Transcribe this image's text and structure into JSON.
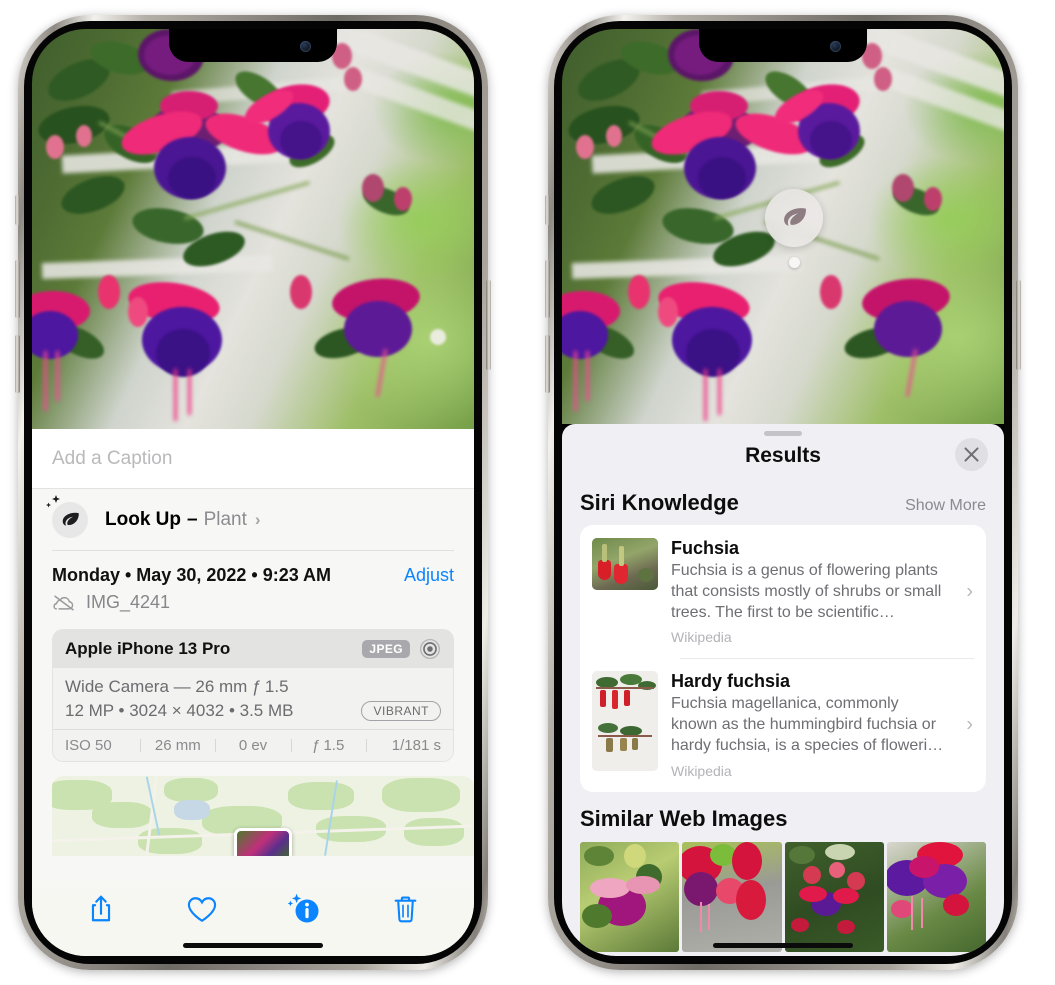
{
  "left_phone": {
    "photo": {
      "alt": "fuchsia-flowers-photo"
    },
    "caption_field": {
      "placeholder": "Add a Caption",
      "value": ""
    },
    "look_up": {
      "label": "Look Up",
      "dash": "–",
      "subject": "Plant",
      "chevron": "›",
      "icon": "leaf-icon",
      "sparkle": "sparkle-icon"
    },
    "metadata": {
      "date_line": "Monday • May 30, 2022 • 9:23 AM",
      "adjust_label": "Adjust",
      "filename": "IMG_4241",
      "cloud_icon": "cloud-slash-icon"
    },
    "exif": {
      "device": "Apple iPhone 13 Pro",
      "format_badge": "JPEG",
      "aperture_icon": "aperture-icon",
      "lens_line": "Wide Camera — 26 mm ƒ 1.5",
      "size_line": "12 MP • 3024 × 4032 • 3.5 MB",
      "style_badge": "VIBRANT",
      "stats": [
        "ISO 50",
        "26 mm",
        "0 ev",
        "ƒ 1.5",
        "1/181 s"
      ]
    },
    "toolbar": {
      "share_label": "share-icon",
      "favorite_label": "heart-icon",
      "info_label": "info-sparkle-icon",
      "delete_label": "trash-icon"
    }
  },
  "right_phone": {
    "visual_look_up_badge": {
      "icon": "leaf-icon"
    },
    "sheet": {
      "title": "Results",
      "close_icon": "close-icon",
      "grabber": "drag-handle"
    },
    "siri_knowledge": {
      "title": "Siri Knowledge",
      "show_more": "Show More",
      "items": [
        {
          "name": "Fuchsia",
          "description": "Fuchsia is a genus of flowering plants that consists mostly of shrubs or small trees. The first to be scientific…",
          "source": "Wikipedia",
          "chevron": "›",
          "thumb": "fuchsia-thumbnail"
        },
        {
          "name": "Hardy fuchsia",
          "description": "Fuchsia magellanica, commonly known as the hummingbird fuchsia or hardy fuchsia, is a species of floweri…",
          "source": "Wikipedia",
          "chevron": "›",
          "thumb": "hardy-fuchsia-thumbnail"
        }
      ]
    },
    "similar_web_images": {
      "title": "Similar Web Images",
      "items": [
        {
          "alt": "fuchsia-web-image-1"
        },
        {
          "alt": "fuchsia-web-image-2"
        },
        {
          "alt": "fuchsia-web-image-3"
        },
        {
          "alt": "fuchsia-web-image-4"
        }
      ]
    }
  },
  "colors": {
    "accent_blue": "#0a84ff",
    "sheet_bg_left": "#f7f7f5",
    "sheet_bg_right": "#f0eff4",
    "card_bg": "#ffffff",
    "secondary_text": "#6e6e73",
    "tertiary_text": "#b3b3b8"
  }
}
